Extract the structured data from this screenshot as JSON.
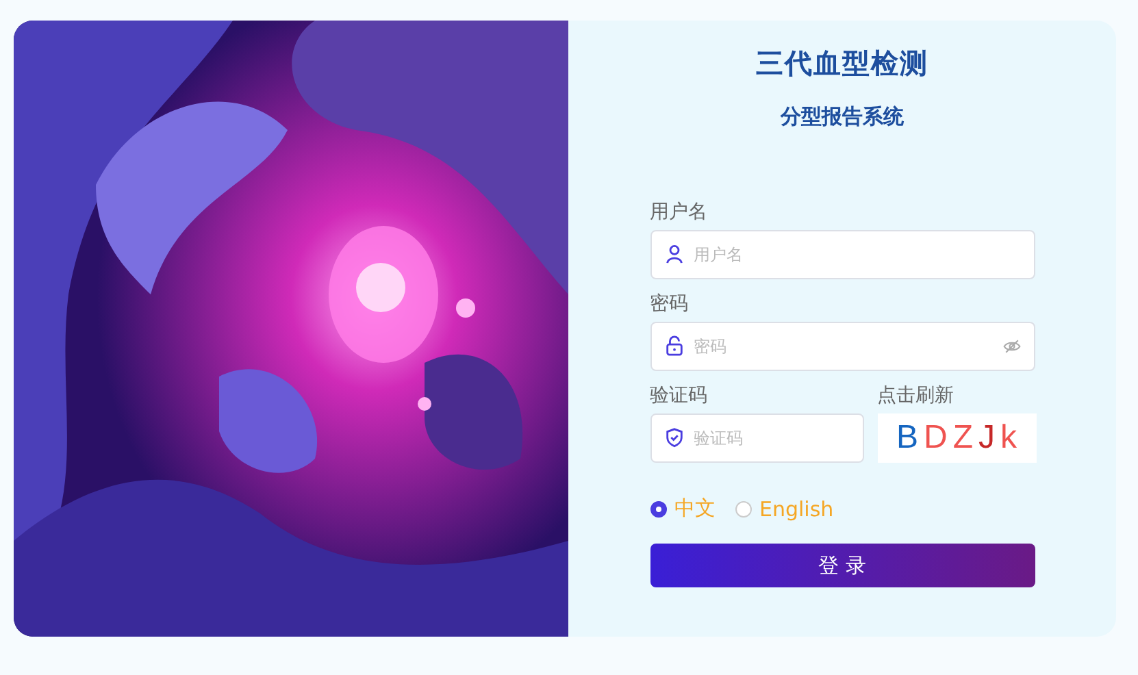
{
  "title": "三代血型检测",
  "subtitle": "分型报告系统",
  "fields": [
    {
      "kind": "user",
      "label": "用户名",
      "placeholder": "用户名"
    },
    {
      "kind": "password",
      "label": "密码",
      "placeholder": "密码"
    }
  ],
  "captcha": {
    "label": "验证码",
    "placeholder": "验证码",
    "refresh_label": "点击刷新",
    "chars": [
      {
        "char": "B",
        "color": "#1565c0"
      },
      {
        "char": "D",
        "color": "#ef5350"
      },
      {
        "char": "Z",
        "color": "#ef5350"
      },
      {
        "char": "J",
        "color": "#c62828"
      },
      {
        "char": "k",
        "color": "#ef5350"
      }
    ]
  },
  "languages": [
    {
      "label": "中文",
      "selected": true
    },
    {
      "label": "English",
      "selected": false
    }
  ],
  "login_button": "登 录"
}
